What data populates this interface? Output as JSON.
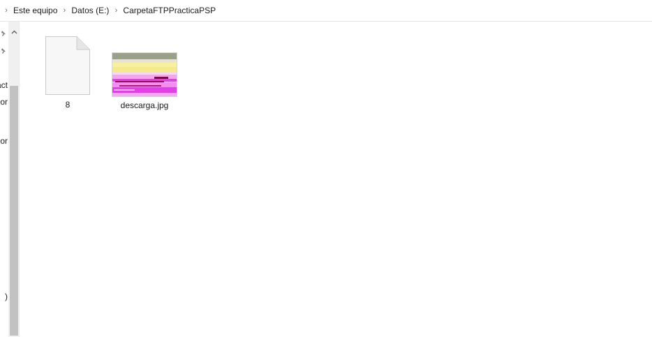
{
  "breadcrumb": {
    "items": [
      "Este equipo",
      "Datos (E:)",
      "CarpetaFTPPracticaPSP"
    ]
  },
  "nav_pane": {
    "items": [
      "act",
      "or",
      "or",
      ")"
    ],
    "pin_icons": [
      "pin-icon",
      "pin-icon"
    ]
  },
  "files": [
    {
      "name": "8",
      "icon": "blank-document-icon"
    },
    {
      "name": "descarga.jpg",
      "icon": "image-thumbnail"
    }
  ],
  "colors": {
    "scroll_thumb": "#c2c2c2",
    "scroll_track": "#f0f0f0",
    "thumb_magenta": "#e23fe6",
    "thumb_yellow": "#f4ec8a"
  }
}
